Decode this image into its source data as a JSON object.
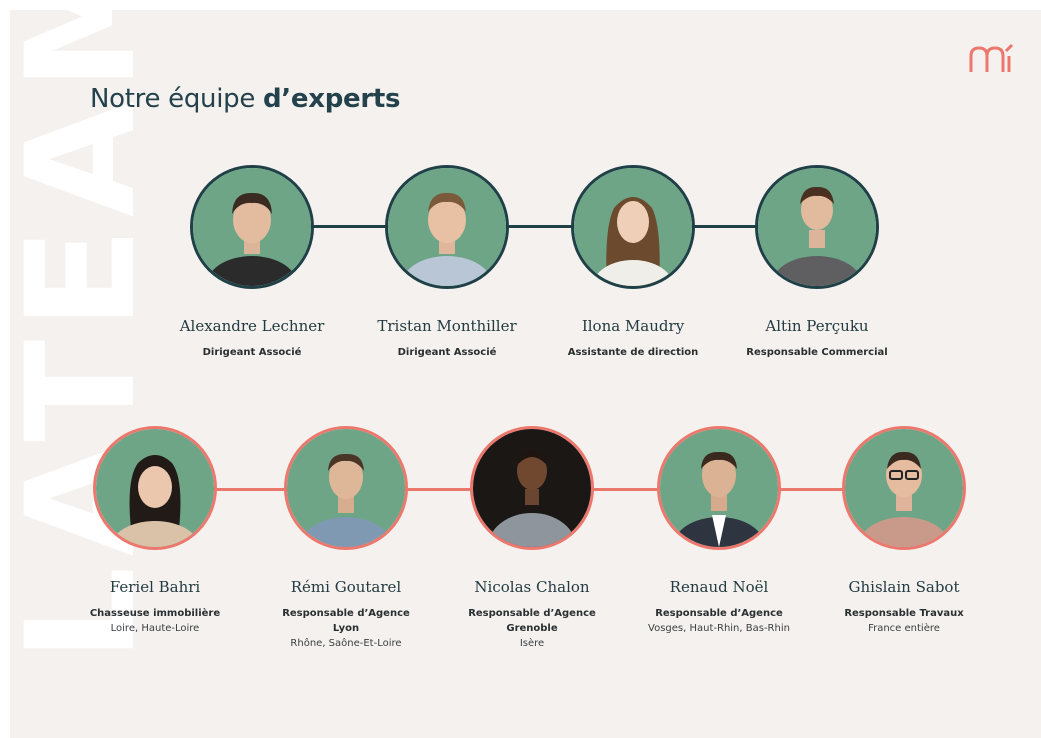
{
  "watermark": "LATEAM",
  "title": {
    "regular": "Notre équipe ",
    "bold": "d’experts"
  },
  "colors": {
    "primary": "#1f4046",
    "accent": "#ec786d",
    "photo_bg": "#6da586"
  },
  "leadership": [
    {
      "name": "Alexandre Lechner",
      "role": "Dirigeant Associé"
    },
    {
      "name": "Tristan Monthiller",
      "role": "Dirigeant Associé"
    },
    {
      "name": "Ilona Maudry",
      "role": "Assistante de direction"
    },
    {
      "name": "Altin Perçuku",
      "role": "Responsable Commercial"
    }
  ],
  "agency_team": [
    {
      "name": "Feriel Bahri",
      "role": "Chasseuse immobilière",
      "city": "",
      "area": "Loire,  Haute-Loire"
    },
    {
      "name": "Rémi Goutarel",
      "role": "Responsable d’Agence",
      "city": "Lyon",
      "area": "Rhône, Saône-Et-Loire"
    },
    {
      "name": "Nicolas Chalon",
      "role": "Responsable d’Agence",
      "city": "Grenoble",
      "area": "Isère"
    },
    {
      "name": "Renaud Noël",
      "role": "Responsable d’Agence",
      "city": "",
      "area": "Vosges, Haut-Rhin, Bas-Rhin"
    },
    {
      "name": "Ghislain Sabot",
      "role": "Responsable Travaux",
      "city": "",
      "area": "France entière"
    }
  ]
}
